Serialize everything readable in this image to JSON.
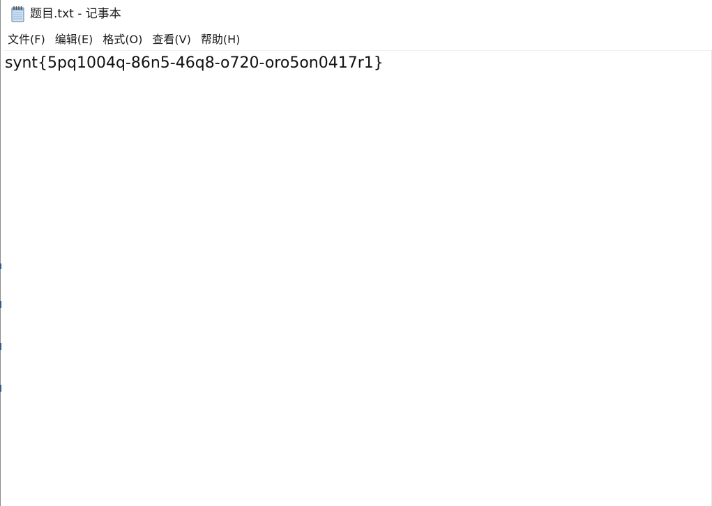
{
  "window": {
    "title": "题目.txt - 记事本",
    "app_icon": "notepad-icon"
  },
  "menu": {
    "items": [
      {
        "label": "文件(F)",
        "name": "menu-file"
      },
      {
        "label": "编辑(E)",
        "name": "menu-edit"
      },
      {
        "label": "格式(O)",
        "name": "menu-format"
      },
      {
        "label": "查看(V)",
        "name": "menu-view"
      },
      {
        "label": "帮助(H)",
        "name": "menu-help"
      }
    ]
  },
  "editor": {
    "content": "synt{5pq1004q-86n5-46q8-o720-oro5on0417r1}"
  },
  "colors": {
    "background": "#ffffff",
    "text": "#111111",
    "window_border": "#8a8a8a"
  }
}
